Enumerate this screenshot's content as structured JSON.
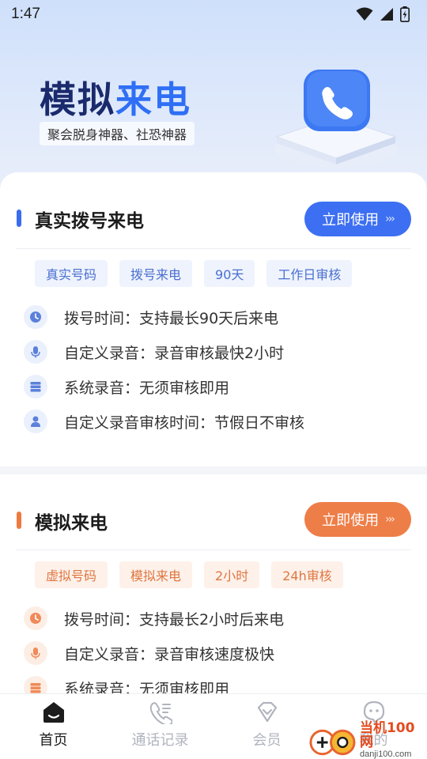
{
  "status_bar": {
    "time": "1:47"
  },
  "hero": {
    "title_dark": "模拟",
    "title_blue": "来电",
    "subtitle": "聚会脱身神器、社恐神器"
  },
  "colors": {
    "blue_accent": "#3a6cf0",
    "orange_accent": "#ee7a3f"
  },
  "cards": [
    {
      "title": "真实拨号来电",
      "button_label": "立即使用",
      "accent": "blue",
      "tags": [
        "真实号码",
        "拨号来电",
        "90天",
        "工作日审核"
      ],
      "features": [
        {
          "icon": "clock-icon",
          "text": "拨号时间：支持最长90天后来电"
        },
        {
          "icon": "microphone-icon",
          "text": "自定义录音：录音审核最快2小时"
        },
        {
          "icon": "server-icon",
          "text": "系统录音：无须审核即用"
        },
        {
          "icon": "person-icon",
          "text": "自定义录音审核时间：节假日不审核"
        }
      ]
    },
    {
      "title": "模拟来电",
      "button_label": "立即使用",
      "accent": "orange",
      "tags": [
        "虚拟号码",
        "模拟来电",
        "2小时",
        "24h审核"
      ],
      "features": [
        {
          "icon": "clock-icon",
          "text": "拨号时间：支持最长2小时后来电"
        },
        {
          "icon": "microphone-icon",
          "text": "自定义录音：录音审核速度极快"
        },
        {
          "icon": "server-icon",
          "text": "系统录音：无须审核即用"
        }
      ]
    }
  ],
  "tabbar": {
    "items": [
      {
        "label": "首页",
        "icon": "home-icon",
        "active": true
      },
      {
        "label": "通话记录",
        "icon": "call-log-icon",
        "active": false
      },
      {
        "label": "会员",
        "icon": "vip-diamond-icon",
        "active": false
      },
      {
        "label": "我的",
        "icon": "profile-icon",
        "active": false
      }
    ]
  },
  "watermark": {
    "main": "当机100网",
    "sub": "danji100.com"
  }
}
